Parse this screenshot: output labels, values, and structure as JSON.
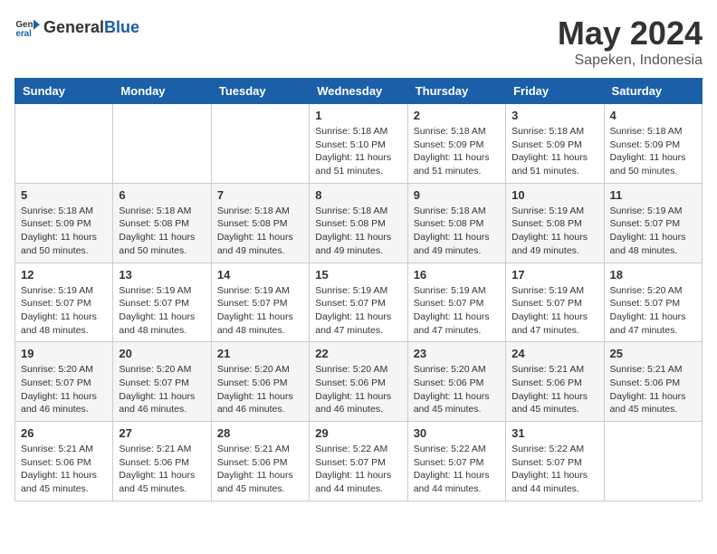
{
  "header": {
    "logo_general": "General",
    "logo_blue": "Blue",
    "month": "May 2024",
    "location": "Sapeken, Indonesia"
  },
  "days_of_week": [
    "Sunday",
    "Monday",
    "Tuesday",
    "Wednesday",
    "Thursday",
    "Friday",
    "Saturday"
  ],
  "weeks": [
    [
      {
        "day": "",
        "info": ""
      },
      {
        "day": "",
        "info": ""
      },
      {
        "day": "",
        "info": ""
      },
      {
        "day": "1",
        "info": "Sunrise: 5:18 AM\nSunset: 5:10 PM\nDaylight: 11 hours and 51 minutes."
      },
      {
        "day": "2",
        "info": "Sunrise: 5:18 AM\nSunset: 5:09 PM\nDaylight: 11 hours and 51 minutes."
      },
      {
        "day": "3",
        "info": "Sunrise: 5:18 AM\nSunset: 5:09 PM\nDaylight: 11 hours and 51 minutes."
      },
      {
        "day": "4",
        "info": "Sunrise: 5:18 AM\nSunset: 5:09 PM\nDaylight: 11 hours and 50 minutes."
      }
    ],
    [
      {
        "day": "5",
        "info": "Sunrise: 5:18 AM\nSunset: 5:09 PM\nDaylight: 11 hours and 50 minutes."
      },
      {
        "day": "6",
        "info": "Sunrise: 5:18 AM\nSunset: 5:08 PM\nDaylight: 11 hours and 50 minutes."
      },
      {
        "day": "7",
        "info": "Sunrise: 5:18 AM\nSunset: 5:08 PM\nDaylight: 11 hours and 49 minutes."
      },
      {
        "day": "8",
        "info": "Sunrise: 5:18 AM\nSunset: 5:08 PM\nDaylight: 11 hours and 49 minutes."
      },
      {
        "day": "9",
        "info": "Sunrise: 5:18 AM\nSunset: 5:08 PM\nDaylight: 11 hours and 49 minutes."
      },
      {
        "day": "10",
        "info": "Sunrise: 5:19 AM\nSunset: 5:08 PM\nDaylight: 11 hours and 49 minutes."
      },
      {
        "day": "11",
        "info": "Sunrise: 5:19 AM\nSunset: 5:07 PM\nDaylight: 11 hours and 48 minutes."
      }
    ],
    [
      {
        "day": "12",
        "info": "Sunrise: 5:19 AM\nSunset: 5:07 PM\nDaylight: 11 hours and 48 minutes."
      },
      {
        "day": "13",
        "info": "Sunrise: 5:19 AM\nSunset: 5:07 PM\nDaylight: 11 hours and 48 minutes."
      },
      {
        "day": "14",
        "info": "Sunrise: 5:19 AM\nSunset: 5:07 PM\nDaylight: 11 hours and 48 minutes."
      },
      {
        "day": "15",
        "info": "Sunrise: 5:19 AM\nSunset: 5:07 PM\nDaylight: 11 hours and 47 minutes."
      },
      {
        "day": "16",
        "info": "Sunrise: 5:19 AM\nSunset: 5:07 PM\nDaylight: 11 hours and 47 minutes."
      },
      {
        "day": "17",
        "info": "Sunrise: 5:19 AM\nSunset: 5:07 PM\nDaylight: 11 hours and 47 minutes."
      },
      {
        "day": "18",
        "info": "Sunrise: 5:20 AM\nSunset: 5:07 PM\nDaylight: 11 hours and 47 minutes."
      }
    ],
    [
      {
        "day": "19",
        "info": "Sunrise: 5:20 AM\nSunset: 5:07 PM\nDaylight: 11 hours and 46 minutes."
      },
      {
        "day": "20",
        "info": "Sunrise: 5:20 AM\nSunset: 5:07 PM\nDaylight: 11 hours and 46 minutes."
      },
      {
        "day": "21",
        "info": "Sunrise: 5:20 AM\nSunset: 5:06 PM\nDaylight: 11 hours and 46 minutes."
      },
      {
        "day": "22",
        "info": "Sunrise: 5:20 AM\nSunset: 5:06 PM\nDaylight: 11 hours and 46 minutes."
      },
      {
        "day": "23",
        "info": "Sunrise: 5:20 AM\nSunset: 5:06 PM\nDaylight: 11 hours and 45 minutes."
      },
      {
        "day": "24",
        "info": "Sunrise: 5:21 AM\nSunset: 5:06 PM\nDaylight: 11 hours and 45 minutes."
      },
      {
        "day": "25",
        "info": "Sunrise: 5:21 AM\nSunset: 5:06 PM\nDaylight: 11 hours and 45 minutes."
      }
    ],
    [
      {
        "day": "26",
        "info": "Sunrise: 5:21 AM\nSunset: 5:06 PM\nDaylight: 11 hours and 45 minutes."
      },
      {
        "day": "27",
        "info": "Sunrise: 5:21 AM\nSunset: 5:06 PM\nDaylight: 11 hours and 45 minutes."
      },
      {
        "day": "28",
        "info": "Sunrise: 5:21 AM\nSunset: 5:06 PM\nDaylight: 11 hours and 45 minutes."
      },
      {
        "day": "29",
        "info": "Sunrise: 5:22 AM\nSunset: 5:07 PM\nDaylight: 11 hours and 44 minutes."
      },
      {
        "day": "30",
        "info": "Sunrise: 5:22 AM\nSunset: 5:07 PM\nDaylight: 11 hours and 44 minutes."
      },
      {
        "day": "31",
        "info": "Sunrise: 5:22 AM\nSunset: 5:07 PM\nDaylight: 11 hours and 44 minutes."
      },
      {
        "day": "",
        "info": ""
      }
    ]
  ]
}
